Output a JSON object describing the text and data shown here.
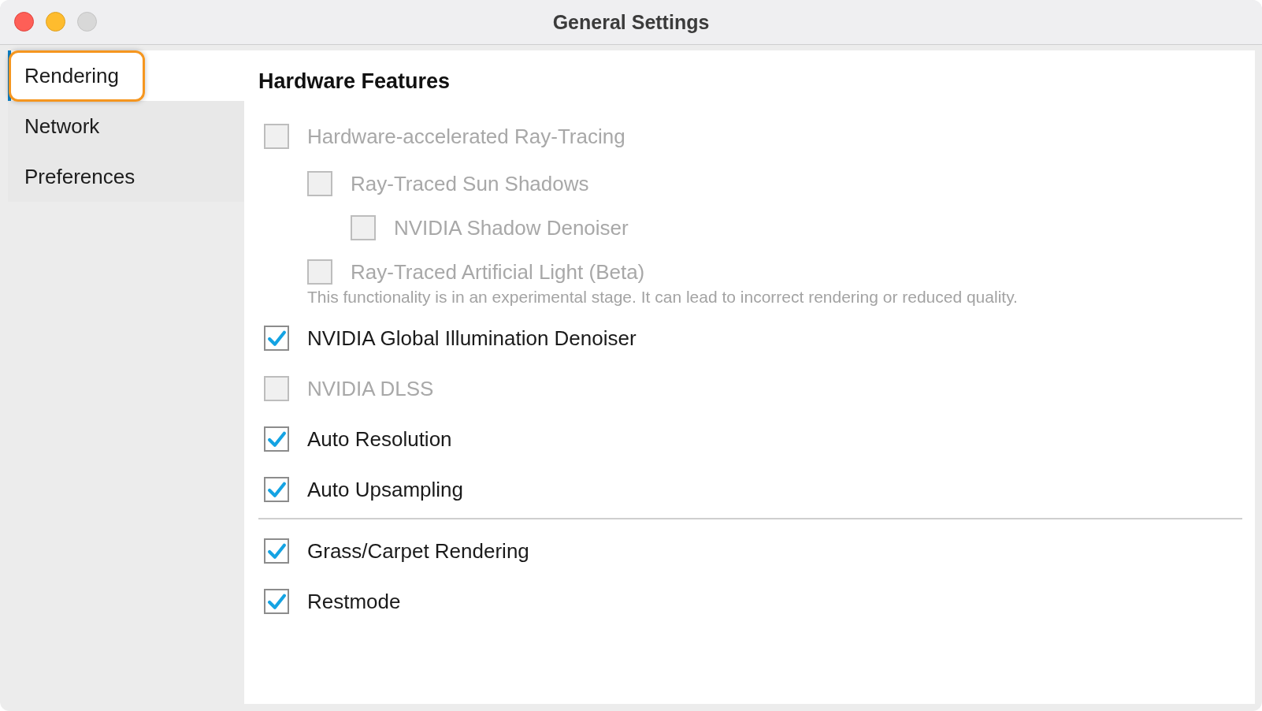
{
  "window": {
    "title": "General Settings"
  },
  "sidebar": {
    "items": [
      {
        "label": "Rendering",
        "selected": true,
        "focused": true
      },
      {
        "label": "Network",
        "selected": false,
        "focused": false
      },
      {
        "label": "Preferences",
        "selected": false,
        "focused": false
      }
    ]
  },
  "section": {
    "title": "Hardware Features",
    "groups": [
      {
        "items": [
          {
            "label": "Hardware-accelerated Ray-Tracing",
            "checked": false,
            "disabled": true,
            "children": [
              {
                "label": "Ray-Traced Sun Shadows",
                "checked": false,
                "disabled": true,
                "children": [
                  {
                    "label": "NVIDIA Shadow Denoiser",
                    "checked": false,
                    "disabled": true
                  }
                ]
              },
              {
                "label": "Ray-Traced Artificial Light (Beta)",
                "checked": false,
                "disabled": true
              }
            ],
            "note": "This functionality is in an experimental stage. It can lead to incorrect rendering or reduced quality."
          },
          {
            "label": "NVIDIA Global Illumination Denoiser",
            "checked": true,
            "disabled": false
          },
          {
            "label": "NVIDIA DLSS",
            "checked": false,
            "disabled": true
          },
          {
            "label": "Auto Resolution",
            "checked": true,
            "disabled": false
          },
          {
            "label": "Auto Upsampling",
            "checked": true,
            "disabled": false
          }
        ]
      },
      {
        "items": [
          {
            "label": "Grass/Carpet Rendering",
            "checked": true,
            "disabled": false
          },
          {
            "label": "Restmode",
            "checked": true,
            "disabled": false
          }
        ]
      }
    ]
  }
}
